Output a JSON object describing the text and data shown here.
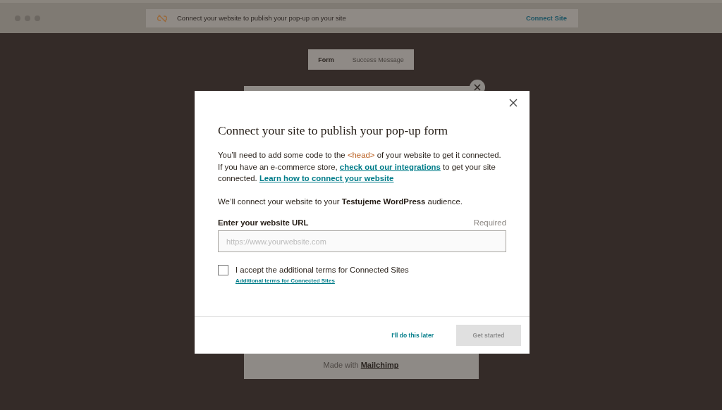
{
  "banner": {
    "text": "Connect your website to publish your pop-up on your site",
    "action": "Connect Site"
  },
  "tabs": [
    {
      "label": "Form",
      "selected": true
    },
    {
      "label": "Success Message",
      "selected": false
    }
  ],
  "form_preview": {
    "footer_text": "Made with",
    "footer_link": "Mailchimp"
  },
  "modal": {
    "title": "Connect your site to publish your pop-up form",
    "intro": [
      {
        "kind": "text",
        "text": "You’ll need to add some code to the "
      },
      {
        "kind": "code",
        "text": "<head>"
      },
      {
        "kind": "text",
        "text": " of your website to get it connected. If you have an e-commerce store, "
      },
      {
        "kind": "link",
        "text": "check out our integrations"
      },
      {
        "kind": "text",
        "text": " to get your site connected. "
      },
      {
        "kind": "link",
        "text": "Learn how to connect your website"
      }
    ],
    "audience_note": "We’ll connect your website to your **Testujeme WordPress** audience.",
    "url_label": "Enter your website URL",
    "url_required": "Required",
    "url_placeholder": "https://www.yourwebsite.com",
    "terms": {
      "label": "I accept the additional terms for Connected Sites",
      "checked": false,
      "link": "Additional terms for Connected Sites"
    },
    "later_button": "I'll do this later",
    "start_button": {
      "label": "Get started",
      "disabled": true
    }
  }
}
